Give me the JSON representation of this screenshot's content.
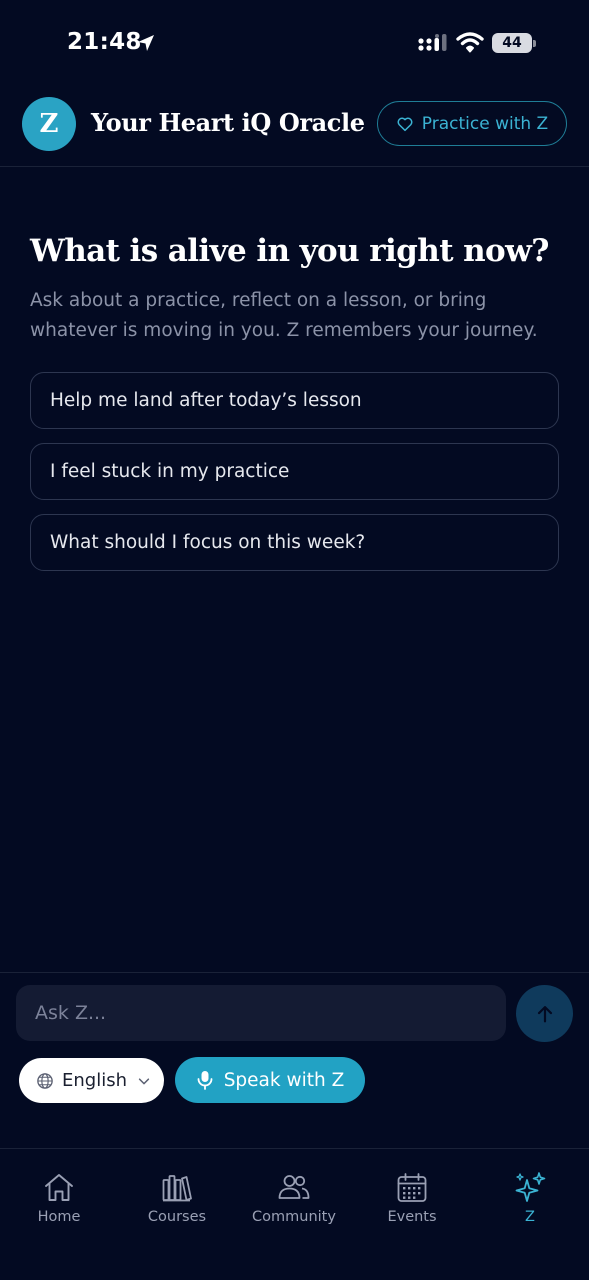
{
  "status_bar": {
    "time": "21:48",
    "battery": "44"
  },
  "header": {
    "avatar_letter": "Z",
    "title": "Your Heart iQ Oracle",
    "practice_button": "Practice with Z"
  },
  "main": {
    "heading": "What is alive in you right now?",
    "subtitle": "Ask about a practice, reflect on a lesson, or bring whatever is moving in you. Z remembers your journey.",
    "suggestions": [
      "Help me land after today’s lesson",
      "I feel stuck in my practice",
      "What should I focus on this week?"
    ]
  },
  "composer": {
    "placeholder": "Ask Z...",
    "language": "English",
    "speak_label": "Speak with Z"
  },
  "nav": {
    "items": [
      {
        "label": "Home",
        "icon": "home-icon"
      },
      {
        "label": "Courses",
        "icon": "books-icon"
      },
      {
        "label": "Community",
        "icon": "people-icon"
      },
      {
        "label": "Events",
        "icon": "calendar-icon"
      },
      {
        "label": "Z",
        "icon": "sparkles-icon"
      }
    ],
    "active": "Z"
  },
  "colors": {
    "background": "#030a22",
    "accent": "#22a2c4",
    "accent_text": "#3bb3d3",
    "muted_text": "#8c93a8",
    "input_bg": "#141b33",
    "send_bg": "#0f3a5c"
  }
}
